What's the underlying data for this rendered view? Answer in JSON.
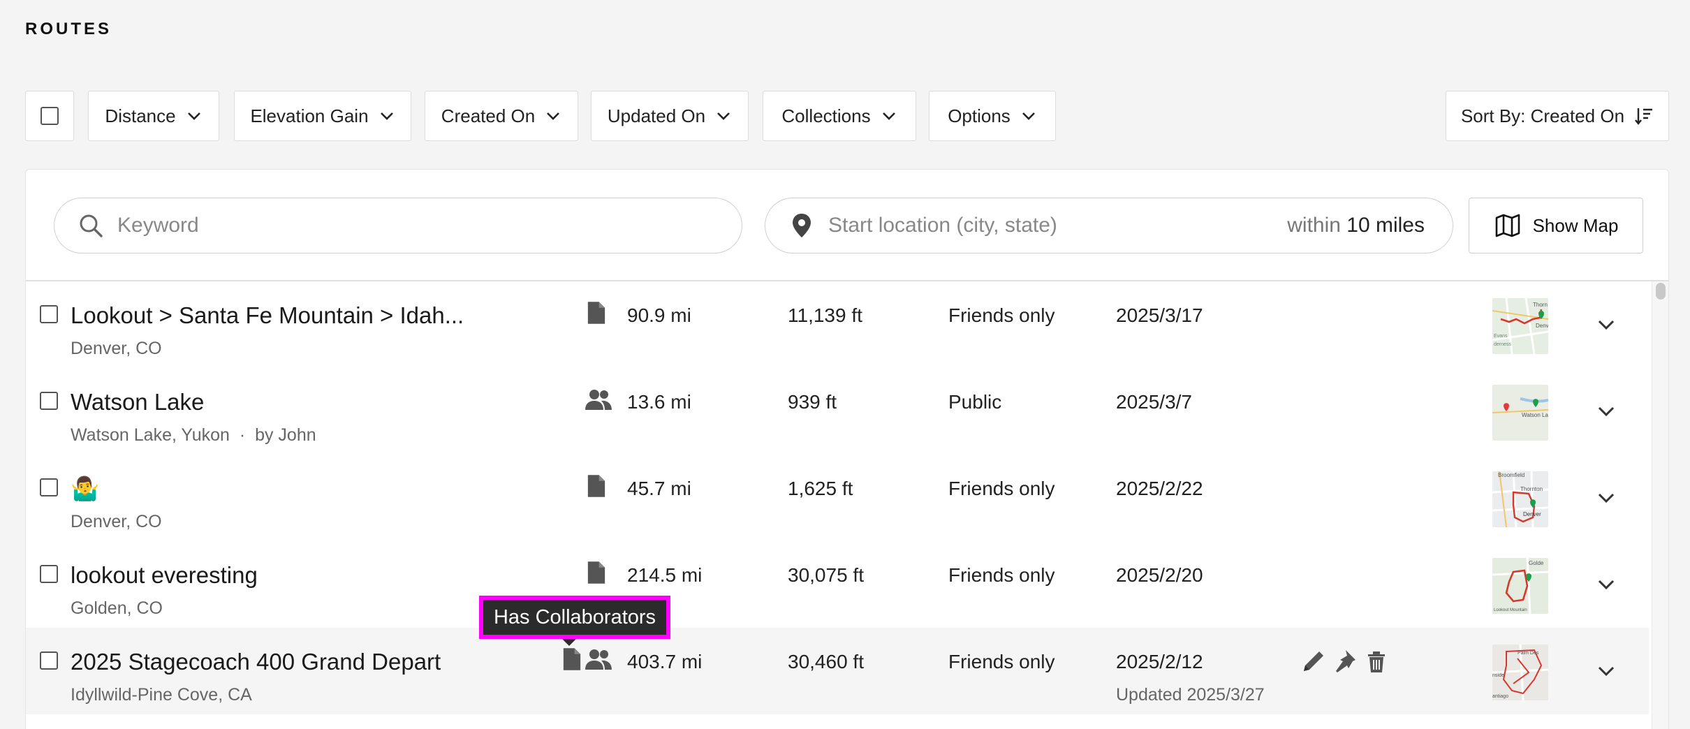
{
  "page": {
    "title": "ROUTES"
  },
  "filters": {
    "distance": "Distance",
    "elevation_gain": "Elevation Gain",
    "created_on": "Created On",
    "updated_on": "Updated On",
    "collections": "Collections",
    "options": "Options",
    "sort": "Sort By: Created On"
  },
  "search": {
    "keyword_placeholder": "Keyword",
    "location_placeholder": "Start location (city, state)",
    "within_prefix": "within",
    "within_value": "10 miles",
    "show_map": "Show Map"
  },
  "routes": [
    {
      "name": "Lookout > Santa Fe Mountain > Idah...",
      "location": "Denver, CO",
      "distance": "90.9 mi",
      "elevation": "11,139 ft",
      "privacy": "Friends only",
      "created": "2025/3/17",
      "icon": "document-icon",
      "map_labels": [
        "Thorn",
        "Denv",
        "Evans",
        "derness"
      ]
    },
    {
      "name": "Watson Lake",
      "location": "Watson Lake, Yukon",
      "owner": "by John",
      "separator": "·",
      "distance": "13.6 mi",
      "elevation": "939 ft",
      "privacy": "Public",
      "created": "2025/3/7",
      "icon": "collaborators-icon",
      "map_labels": [
        "Watson Lak"
      ]
    },
    {
      "name": "🤷‍♂️",
      "location": "Denver, CO",
      "distance": "45.7 mi",
      "elevation": "1,625 ft",
      "privacy": "Friends only",
      "created": "2025/2/22",
      "icon": "document-icon",
      "map_labels": [
        "Broomfield",
        "Thornton",
        "Denver"
      ]
    },
    {
      "name": "lookout everesting",
      "location": "Golden, CO",
      "distance": "214.5 mi",
      "elevation": "30,075 ft",
      "privacy": "Friends only",
      "created": "2025/2/20",
      "icon": "document-icon",
      "map_labels": [
        "Golde",
        "Lookout Mountain"
      ]
    },
    {
      "name": "2025 Stagecoach 400 Grand Depart",
      "location": "Idyllwild-Pine Cove, CA",
      "distance": "403.7 mi",
      "elevation": "30,460 ft",
      "privacy": "Friends only",
      "created": "2025/2/12",
      "updated": "Updated 2025/3/27",
      "icons": [
        "document-icon",
        "collaborators-icon"
      ],
      "map_labels": [
        "Palm Des",
        "nside",
        "antiago"
      ]
    }
  ],
  "tooltip": {
    "text": "Has Collaborators"
  },
  "colors": {
    "highlight": "#ff00ff",
    "route_red": "#d9372b",
    "pin_green": "#1e9e4a",
    "pin_red": "#e23b3b"
  }
}
